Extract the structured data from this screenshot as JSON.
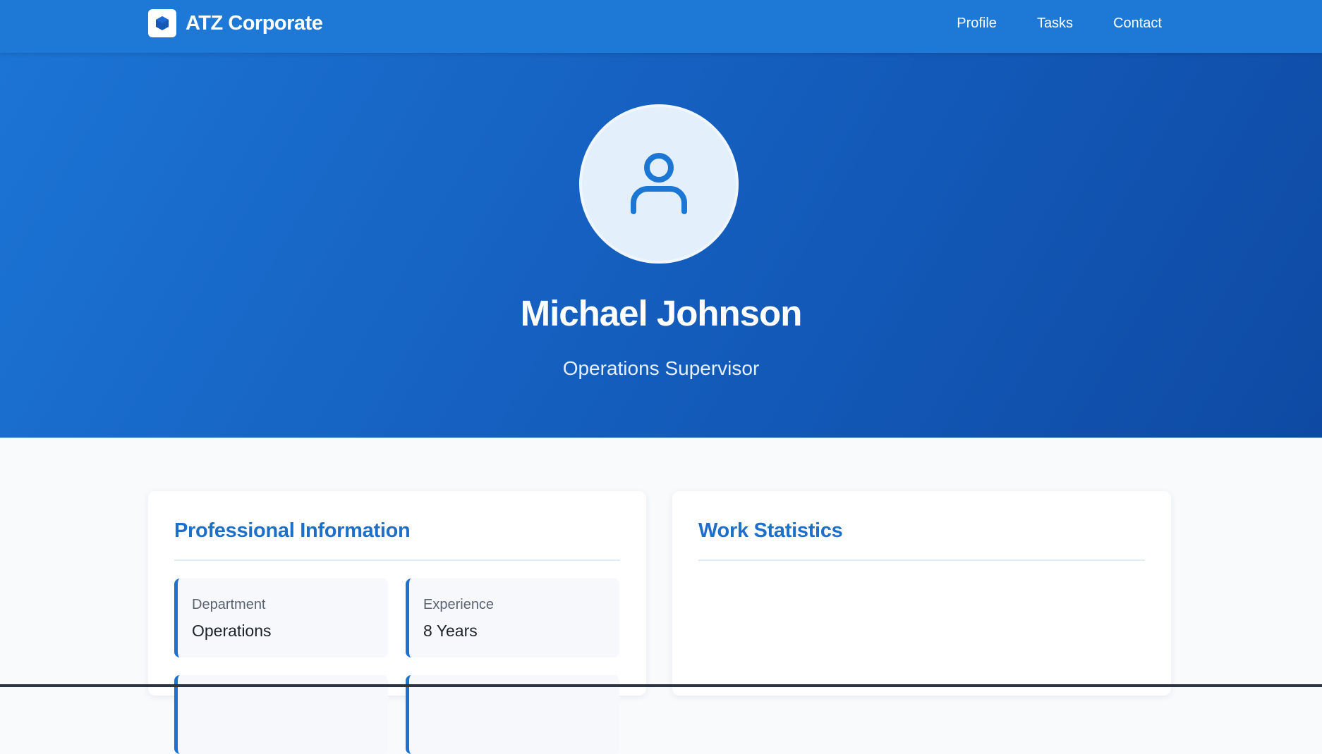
{
  "brand": {
    "name": "ATZ Corporate",
    "logo_icon": "cube-icon"
  },
  "nav": {
    "items": [
      {
        "label": "Profile"
      },
      {
        "label": "Tasks"
      },
      {
        "label": "Contact"
      }
    ]
  },
  "profile": {
    "avatar_icon": "user-icon",
    "name": "Michael Johnson",
    "title": "Operations Supervisor"
  },
  "professional_info": {
    "heading": "Professional Information",
    "tiles": [
      {
        "label": "Department",
        "value": "Operations"
      },
      {
        "label": "Experience",
        "value": "8 Years"
      }
    ]
  },
  "work_stats": {
    "heading": "Work Statistics"
  },
  "colors": {
    "primary": "#1d78d6",
    "hero_gradient_end": "#0e4aa4",
    "heading": "#1d6fc9",
    "background": "#f8fafc"
  }
}
